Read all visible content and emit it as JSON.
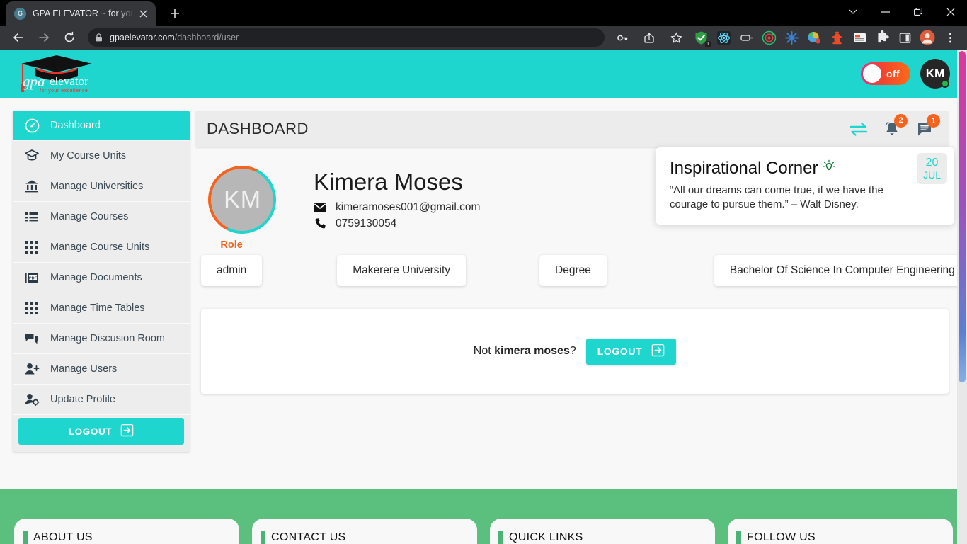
{
  "browser": {
    "tab": {
      "title": "GPA ELEVATOR ~ for your excelle",
      "favicon_letter": "G",
      "favicon_name": "site-favicon"
    },
    "newtab_label": "+",
    "window_controls": {
      "search_tabs": "⌄",
      "minimize": "—",
      "maximize": "❐",
      "close": "✕"
    },
    "nav": {
      "back": "←",
      "forward": "→",
      "reload": "⟳"
    },
    "omnibox": {
      "lock": "lock-icon",
      "domain": "gpaelevator.com",
      "path": "/dashboard/user"
    },
    "omni_actions": [
      "password-key-icon",
      "share-icon",
      "bookmark-star-icon"
    ],
    "extensions": [
      {
        "name": "shield-extension-icon",
        "badge": "1"
      },
      {
        "name": "react-devtools-icon",
        "badge": ""
      },
      {
        "name": "screen-capture-icon",
        "badge": ""
      },
      {
        "name": "target-extension-icon",
        "badge": ""
      },
      {
        "name": "blue-flower-extension-icon",
        "badge": ""
      },
      {
        "name": "paint-extension-icon",
        "badge": ""
      },
      {
        "name": "fire-hydrant-extension-icon",
        "badge": ""
      },
      {
        "name": "notes-extension-icon",
        "badge": ""
      },
      {
        "name": "puzzle-extensions-icon",
        "badge": ""
      },
      {
        "name": "sidepanel-icon",
        "badge": ""
      },
      {
        "name": "profile-avatar-icon",
        "badge": ""
      },
      {
        "name": "chrome-menu-icon",
        "badge": ""
      }
    ]
  },
  "app": {
    "logo": {
      "text": "gpa elevator",
      "tagline": "for your excellence"
    },
    "header": {
      "toggle_label": "off",
      "avatar_initials": "KM"
    },
    "sidebar": {
      "items": [
        {
          "label": "Dashboard",
          "icon": "speedometer-icon",
          "active": true
        },
        {
          "label": "My Course Units",
          "icon": "graduation-cap-icon",
          "active": false
        },
        {
          "label": "Manage Universities",
          "icon": "bank-icon",
          "active": false
        },
        {
          "label": "Manage Courses",
          "icon": "list-icon",
          "active": false
        },
        {
          "label": "Manage Course Units",
          "icon": "grid-icon",
          "active": false
        },
        {
          "label": "Manage Documents",
          "icon": "pdf-icon",
          "active": false
        },
        {
          "label": "Manage Time Tables",
          "icon": "grid-icon",
          "active": false
        },
        {
          "label": "Manage Discusion Room",
          "icon": "chat-icon",
          "active": false
        },
        {
          "label": "Manage Users",
          "icon": "user-add-icon",
          "active": false
        },
        {
          "label": "Update Profile",
          "icon": "user-gear-icon",
          "active": false
        }
      ],
      "logout_label": "LOGOUT"
    },
    "main": {
      "title": "DASHBOARD",
      "head_icons": [
        {
          "name": "exchange-icon",
          "badge": ""
        },
        {
          "name": "bell-icon",
          "badge": "2"
        },
        {
          "name": "messages-icon",
          "badge": "1"
        }
      ],
      "profile": {
        "avatar_initials": "KM",
        "name": "Kimera Moses",
        "email": "kimeramoses001@gmail.com",
        "phone": "0759130054"
      },
      "quote": {
        "title": "Inspirational Corner",
        "text": "“All our dreams can come true, if we have the courage to pursue them.” – Walt Disney.",
        "date_day": "20",
        "date_month": "JUL"
      },
      "chips": [
        {
          "label": "Role",
          "value": "admin"
        },
        {
          "label": "",
          "value": "Makerere University"
        },
        {
          "label": "",
          "value": "Degree"
        },
        {
          "label": "",
          "value": "Bachelor Of Science In Computer Engineering"
        }
      ],
      "logout_card": {
        "prefix": "Not ",
        "username": "kimera moses",
        "suffix": "?",
        "button_label": "LOGOUT"
      }
    },
    "footer": {
      "cards": [
        {
          "title": "ABOUT US"
        },
        {
          "title": "CONTACT US"
        },
        {
          "title": "QUICK LINKS"
        },
        {
          "title": "FOLLOW US"
        }
      ]
    },
    "colors": {
      "brand_teal": "#1ed6cd",
      "accent_orange": "#f4641e",
      "footer_green": "#5bbf7e"
    }
  }
}
